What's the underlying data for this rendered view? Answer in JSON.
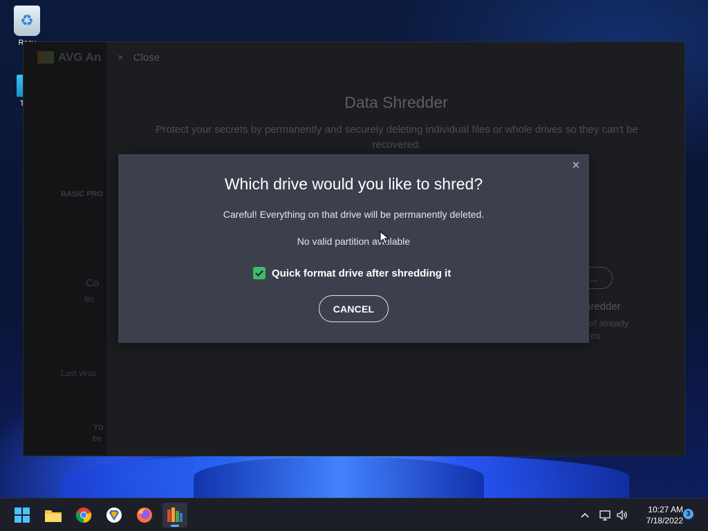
{
  "desktop": {
    "icons": [
      {
        "label": "Recy"
      },
      {
        "label": "Th"
      }
    ]
  },
  "avg_window": {
    "brand": "AVG An",
    "close_label": "Close",
    "title": "Data Shredder",
    "description": "Protect your secrets by permanently and securely deleting individual files or whole drives so they can't be recovered.",
    "sidebar_heading": "BASIC PRO",
    "sidebar_text_1": "Co",
    "sidebar_text_2": "fin",
    "sidebar_footer": "Last virus",
    "browse_label": "s...",
    "right_title": "hredder",
    "right_desc_1": "of already",
    "right_desc_2": "es.",
    "bottom_text_1": "Yo",
    "bottom_text_2": "Be"
  },
  "dialog": {
    "title": "Which drive would you like to shred?",
    "warning": "Careful! Everything on that drive will be permanently deleted.",
    "status": "No valid partition available",
    "quick_format_label": "Quick format drive after shredding it",
    "quick_format_checked": true,
    "cancel_label": "CANCEL"
  },
  "taskbar": {
    "apps": [
      "start-icon",
      "file-explorer-icon",
      "chrome-icon",
      "brave-icon",
      "firefox-icon",
      "avg-icon"
    ],
    "active_app": "avg-icon",
    "time": "10:27 AM",
    "date": "7/18/2022",
    "notification_count": "3"
  },
  "colors": {
    "dialog_bg": "#3c3f4c",
    "checkbox_green": "#3dbb6a",
    "taskbar_bg": "#1c1f28"
  }
}
